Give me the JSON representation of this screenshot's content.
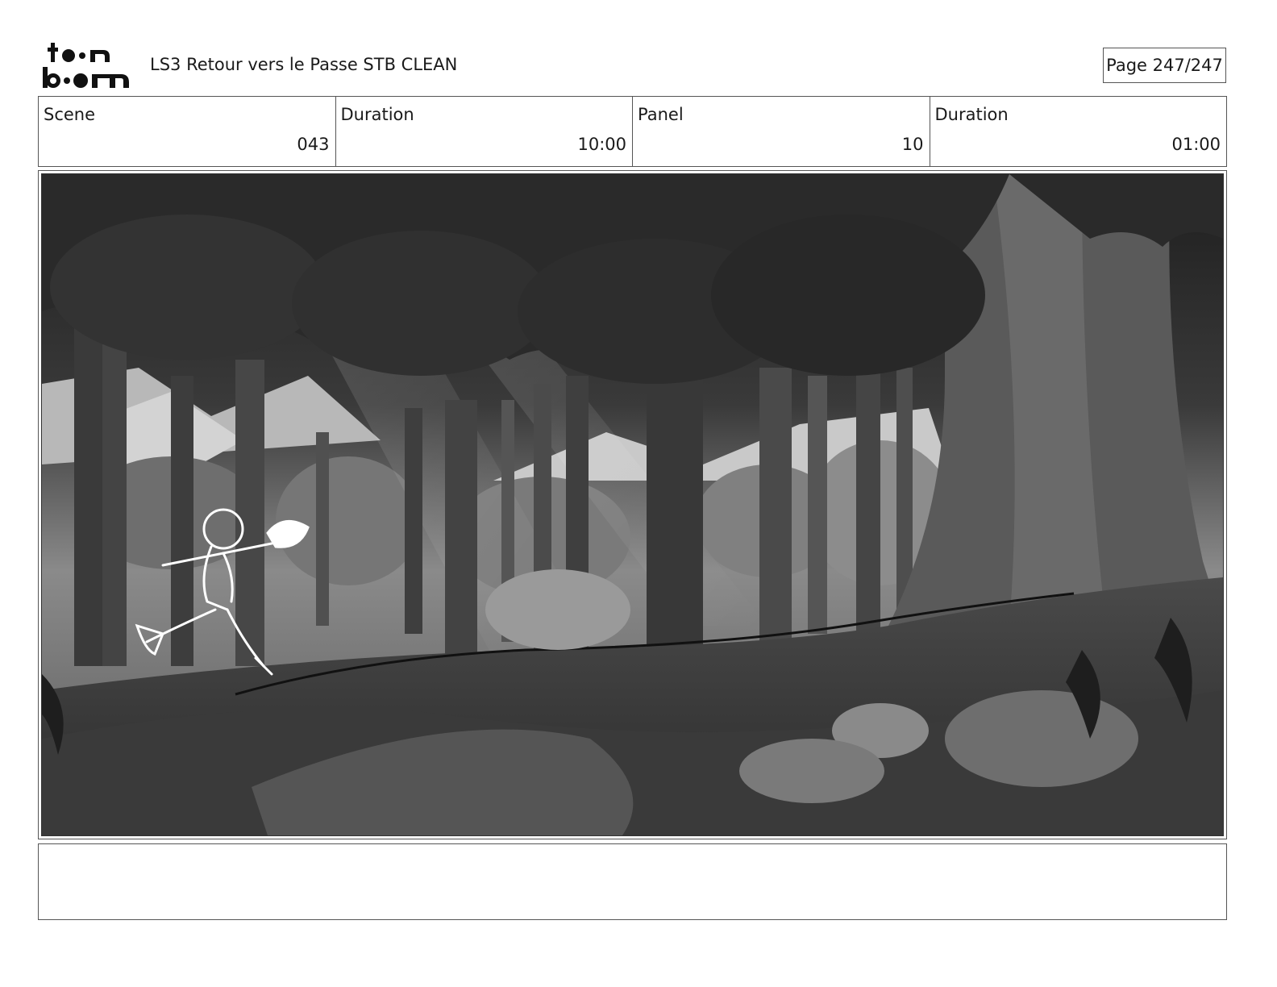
{
  "header": {
    "logo_text": "toonboom",
    "title": "LS3 Retour vers le Passe STB CLEAN",
    "page": "Page 247/247"
  },
  "info": {
    "scene_label": "Scene",
    "scene_value": "043",
    "scene_duration_label": "Duration",
    "scene_duration_value": "10:00",
    "panel_label": "Panel",
    "panel_value": "10",
    "panel_duration_label": "Duration",
    "panel_duration_value": "01:00"
  },
  "panel": {
    "image_name": "forest-storyboard-panel"
  },
  "caption": {
    "text": ""
  }
}
